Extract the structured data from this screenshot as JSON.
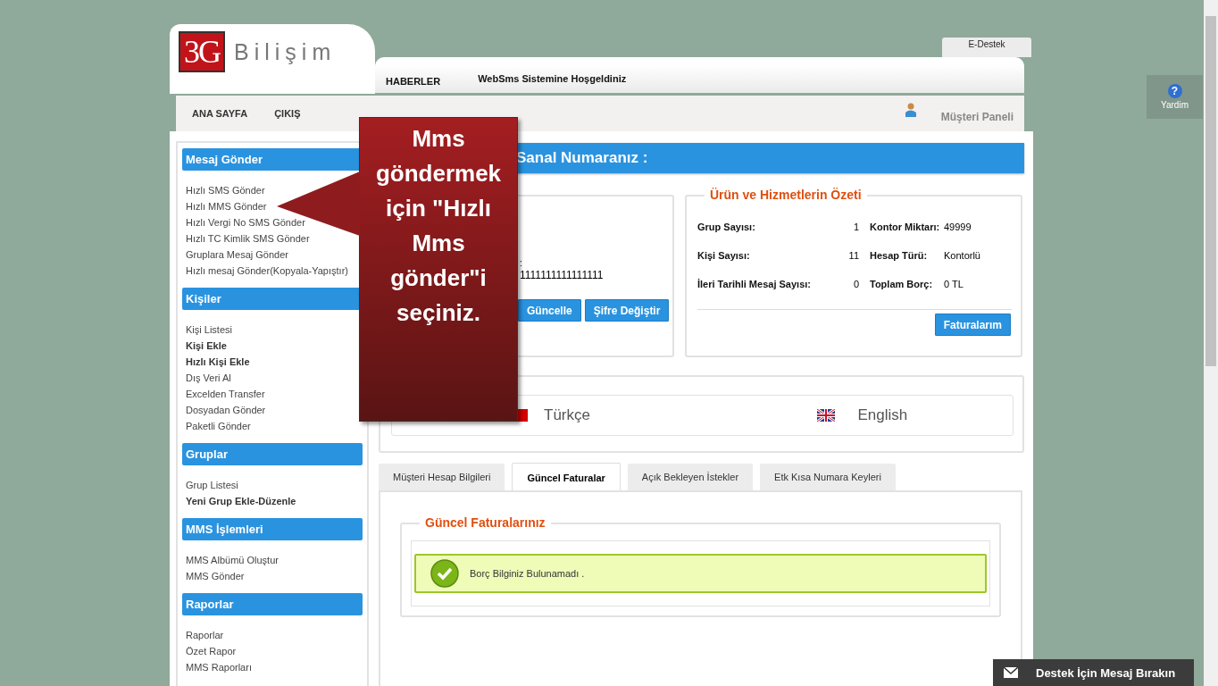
{
  "header": {
    "logo_mark": "3G",
    "logo_text": "Bilişim",
    "e_destek": "E-Destek",
    "news_label": "HABERLER",
    "news_text": "WebSms Sistemine Hoşgeldiniz"
  },
  "nav": {
    "items": [
      "ANA SAYFA",
      "ÇIKIŞ"
    ],
    "panel": "Müşteri Paneli"
  },
  "sidebar": [
    {
      "title": "Mesaj Gönder",
      "items": [
        {
          "label": "Hızlı SMS Gönder",
          "bold": false
        },
        {
          "label": "Hızlı MMS Gönder",
          "bold": false
        },
        {
          "label": "Hızlı Vergi No SMS Gönder",
          "bold": false
        },
        {
          "label": "Hızlı TC Kimlik SMS Gönder",
          "bold": false
        },
        {
          "label": "Gruplara Mesaj Gönder",
          "bold": false
        },
        {
          "label": "Hızlı mesaj Gönder(Kopyala-Yapıştır)",
          "bold": false
        }
      ]
    },
    {
      "title": "Kişiler",
      "items": [
        {
          "label": "Kişi Listesi",
          "bold": false
        },
        {
          "label": "Kişi Ekle",
          "bold": true
        },
        {
          "label": "Hızlı Kişi Ekle",
          "bold": true
        },
        {
          "label": "Dış Veri Al",
          "bold": false
        },
        {
          "label": "Excelden Transfer",
          "bold": false
        },
        {
          "label": "Dosyadan Gönder",
          "bold": false
        },
        {
          "label": "Paketli Gönder",
          "bold": false
        }
      ]
    },
    {
      "title": "Gruplar",
      "items": [
        {
          "label": "Grup Listesi",
          "bold": false
        },
        {
          "label": "Yeni Grup Ekle-Düzenle",
          "bold": true
        }
      ]
    },
    {
      "title": "MMS İşlemleri",
      "items": [
        {
          "label": "MMS Albümü Oluştur",
          "bold": false
        },
        {
          "label": "MMS Gönder",
          "bold": false
        }
      ]
    },
    {
      "title": "Raporlar",
      "items": [
        {
          "label": "Raporlar",
          "bold": false
        },
        {
          "label": "Özet Rapor",
          "bold": false
        },
        {
          "label": "MMS Raporları",
          "bold": false
        }
      ]
    }
  ],
  "account": {
    "title": "Sanal Numaranız :",
    "fragment": ":",
    "number": "1111111111111111",
    "buttons": [
      "Güncelle",
      "Şifre Değiştir"
    ]
  },
  "summary": {
    "title": "Ürün ve Hizmetlerin Özeti",
    "rows": [
      {
        "label": "Grup Sayısı:",
        "value": "1",
        "label2": "Kontor Miktarı:",
        "value2": "49999"
      },
      {
        "label": "Kişi Sayısı:",
        "value": "11",
        "label2": "Hesap Türü:",
        "value2": "Kontorlü"
      },
      {
        "label": "İleri Tarihli Mesaj Sayısı:",
        "value": "0",
        "label2": "Toplam Borç:",
        "value2": "0 TL"
      }
    ],
    "button": "Faturalarım"
  },
  "languages": [
    {
      "label": "Türkçe",
      "kind": "tr"
    },
    {
      "label": "English",
      "kind": "uk"
    }
  ],
  "tabs": [
    {
      "label": "Müşteri Hesap Bilgileri",
      "selected": false
    },
    {
      "label": "Güncel Faturalar",
      "selected": true
    },
    {
      "label": "Açık Bekleyen İstekler",
      "selected": false
    },
    {
      "label": "Etk Kısa Numara Keyleri",
      "selected": false
    }
  ],
  "invoices": {
    "title": "Güncel Faturalarınız",
    "message": "Borç Bilginiz Bulunamadı ."
  },
  "callout": {
    "text": "Mms göndermek için \"Hızlı Mms gönder\"i seçiniz."
  },
  "help": {
    "icon": "?",
    "label": "Yardim"
  },
  "support": {
    "label": "Destek İçin Mesaj Bırakın"
  }
}
